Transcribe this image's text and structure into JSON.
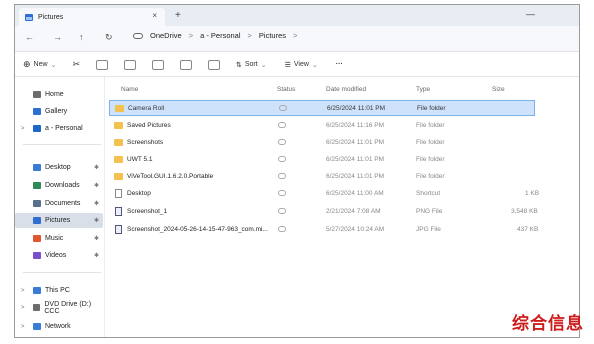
{
  "tab": {
    "title": "Pictures",
    "close": "×",
    "new": "+"
  },
  "window": {
    "minimize": "—"
  },
  "nav": {
    "back": "←",
    "forward": "→",
    "up": "↑",
    "refresh": "↻"
  },
  "breadcrumbs": [
    "OneDrive",
    "a - Personal",
    "Pictures"
  ],
  "breadcrumb_sep": ">",
  "toolbar": {
    "new_label": "New",
    "sort_label": "Sort",
    "view_label": "View",
    "more_label": "···"
  },
  "sidebar": {
    "top": [
      {
        "label": "Home",
        "icon": "home-icon",
        "color": "#6c6c6c"
      },
      {
        "label": "Gallery",
        "icon": "gallery-icon",
        "color": "#2f6fd1"
      },
      {
        "label": "a - Personal",
        "icon": "cloud-icon",
        "color": "#1b66c9"
      }
    ],
    "pinned": [
      {
        "label": "Desktop",
        "icon": "desktop-icon",
        "color": "#3a7bd5",
        "pin": "✱"
      },
      {
        "label": "Downloads",
        "icon": "downloads-icon",
        "color": "#2e8b57",
        "pin": "✱"
      },
      {
        "label": "Documents",
        "icon": "documents-icon",
        "color": "#5a6f8a",
        "pin": "✱"
      },
      {
        "label": "Pictures",
        "icon": "pictures-icon",
        "color": "#2f6fd1",
        "pin": "✱"
      },
      {
        "label": "Music",
        "icon": "music-icon",
        "color": "#e0562f",
        "pin": "✱"
      },
      {
        "label": "Videos",
        "icon": "videos-icon",
        "color": "#7a4fc9",
        "pin": "✱"
      }
    ],
    "bottom": [
      {
        "label": "This PC",
        "icon": "pc-icon",
        "color": "#3a7bd5"
      },
      {
        "label": "DVD Drive (D:) CCC",
        "icon": "dvd-icon",
        "color": "#6c6c6c"
      },
      {
        "label": "Network",
        "icon": "network-icon",
        "color": "#3a7bd5"
      }
    ],
    "expand_glyph": ">"
  },
  "columns": {
    "name": "Name",
    "status": "Status",
    "date": "Date modified",
    "type": "Type",
    "size": "Size"
  },
  "files": [
    {
      "name": "Camera Roll",
      "date": "6/25/2024 11:01 PM",
      "type": "File folder",
      "size": "",
      "kind": "folder"
    },
    {
      "name": "Saved Pictures",
      "date": "6/25/2024 11:16 PM",
      "type": "File folder",
      "size": "",
      "kind": "folder"
    },
    {
      "name": "Screenshots",
      "date": "6/25/2024 11:01 PM",
      "type": "File folder",
      "size": "",
      "kind": "folder"
    },
    {
      "name": "UWT 5.1",
      "date": "6/25/2024 11:01 PM",
      "type": "File folder",
      "size": "",
      "kind": "folder"
    },
    {
      "name": "ViVeTool.GUI.1.6.2.0.Portable",
      "date": "6/25/2024 11:01 PM",
      "type": "File folder",
      "size": "",
      "kind": "folder"
    },
    {
      "name": "Desktop",
      "date": "6/25/2024 11:00 AM",
      "type": "Shortcut",
      "size": "1 KB",
      "kind": "file"
    },
    {
      "name": "Screenshot_1",
      "date": "2/21/2024 7:08 AM",
      "type": "PNG File",
      "size": "3,548 KB",
      "kind": "image"
    },
    {
      "name": "Screenshot_2024-05-26-14-15-47-963_com.mi...",
      "date": "5/27/2024 10:24 AM",
      "type": "JPG File",
      "size": "437 KB",
      "kind": "image"
    }
  ],
  "watermark": "综合信息"
}
